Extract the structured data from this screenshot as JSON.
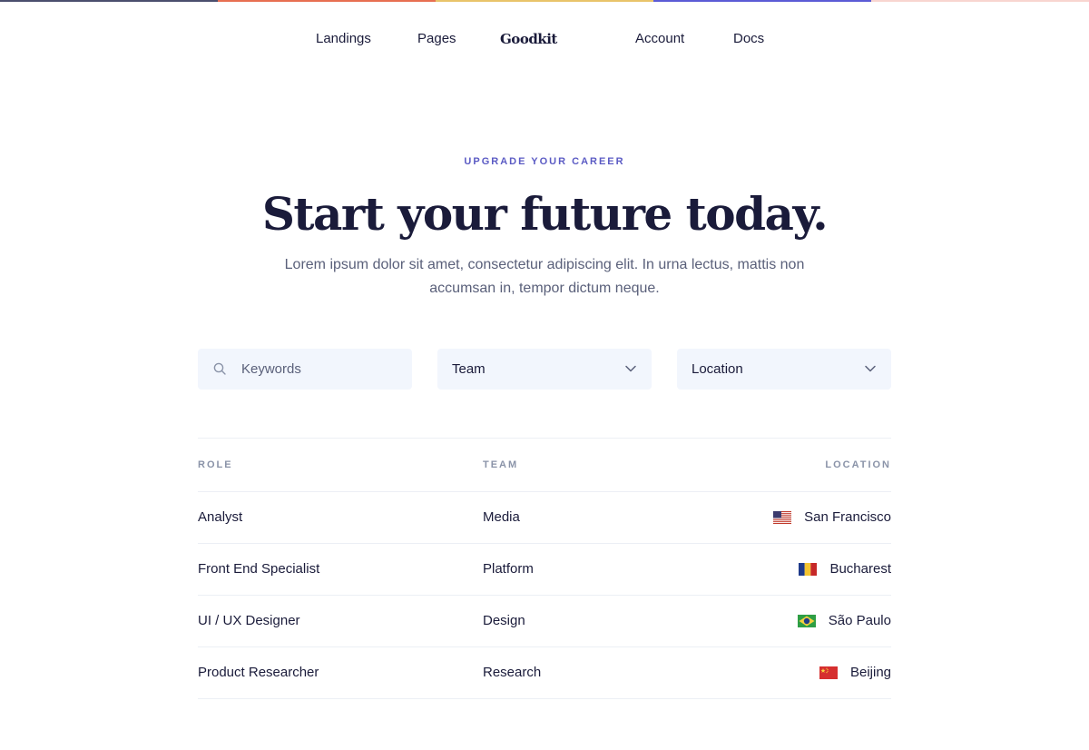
{
  "accent_bar": [
    "#4b4e6d",
    "#e76f51",
    "#e9c46a",
    "#5b5bd6",
    "#f8d5d0"
  ],
  "nav": {
    "links": [
      "Landings",
      "Pages",
      "Account",
      "Docs"
    ],
    "logo": "Goodkit"
  },
  "hero": {
    "eyebrow": "UPGRADE YOUR CAREER",
    "title": "Start your future today.",
    "subtitle": "Lorem ipsum dolor sit amet, consectetur adipiscing elit. In urna lectus, mattis non accumsan in, tempor dictum neque."
  },
  "filters": {
    "keywords_placeholder": "Keywords",
    "team_selected": "Team",
    "location_selected": "Location"
  },
  "table": {
    "headers": [
      "ROLE",
      "TEAM",
      "LOCATION"
    ],
    "rows": [
      {
        "role": "Analyst",
        "team": "Media",
        "location": "San Francisco",
        "flag": "us-flag-icon"
      },
      {
        "role": "Front End Specialist",
        "team": "Platform",
        "location": "Bucharest",
        "flag": "ro-flag-icon"
      },
      {
        "role": "UI / UX Designer",
        "team": "Design",
        "location": "São Paulo",
        "flag": "br-flag-icon"
      },
      {
        "role": "Product Researcher",
        "team": "Research",
        "location": "Beijing",
        "flag": "cn-flag-icon"
      }
    ]
  },
  "colors": {
    "accent": "#5b5bc4",
    "text": "#1a1b3a",
    "muted": "#5a607a",
    "field_bg": "#f2f6fd"
  }
}
